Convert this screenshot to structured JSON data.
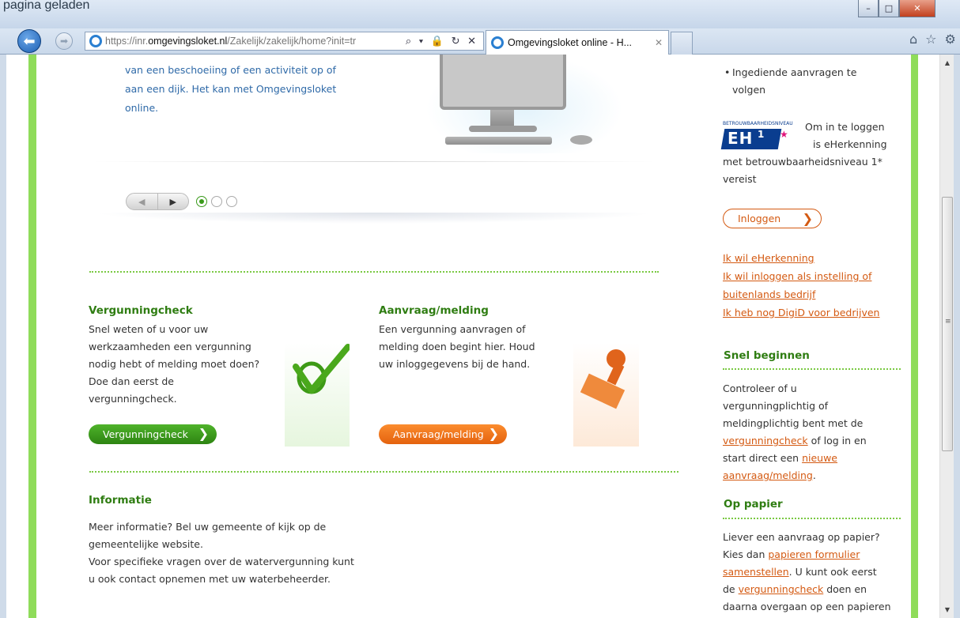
{
  "top_fragment": "pagina geladen",
  "window_controls": {
    "minimize": "–",
    "maximize": "□",
    "close": "✕"
  },
  "nav": {
    "back": "back",
    "forward": "forward"
  },
  "address": {
    "url_prefix": "https://inr.",
    "url_domain": "omgevingsloket.nl",
    "url_path": "/Zakelijk/zakelijk/home?init=tr",
    "controls": "⌕ ▾ 🔒 ↻ ✕"
  },
  "tab": {
    "title": "Omgevingsloket online - H...",
    "close": "✕"
  },
  "toolbar_icons": {
    "home": "⌂",
    "favorites": "☆",
    "tools": "⚙"
  },
  "hero": {
    "text_lines": [
      "van een beschoeiing of een activiteit op of",
      "aan een dijk. Het kan met Omgevingsloket",
      "online."
    ],
    "slider_prev": "◀",
    "slider_next": "▶",
    "slides": [
      {
        "active": true
      },
      {
        "active": false
      },
      {
        "active": false
      }
    ]
  },
  "vergunningcheck": {
    "heading": "Vergunningcheck",
    "lines": [
      "Snel weten of u voor uw",
      "werkzaamheden een vergunning",
      "nodig hebt of melding moet doen?",
      "Doe dan eerst de",
      "vergunningcheck."
    ],
    "button": "Vergunningcheck",
    "button_color": "#3a9a1a"
  },
  "aanvraag": {
    "heading": "Aanvraag/melding",
    "lines": [
      "Een vergunning aanvragen of",
      "melding doen begint hier. Houd",
      "uw inloggegevens bij de hand."
    ],
    "button": "Aanvraag/melding",
    "button_color": "#f07818"
  },
  "informatie": {
    "heading": "Informatie",
    "lines": [
      "Meer informatie? Bel uw gemeente of kijk op de",
      "gemeentelijke website.",
      "Voor specifieke vragen over de watervergunning kunt",
      "u ook contact opnemen met uw waterbeheerder."
    ]
  },
  "sidebar": {
    "bullet_lines": [
      "Ingediende aanvragen te",
      "volgen"
    ],
    "logo_caption": "BETROUWBAARHEIDSNIVEAU",
    "logo_text": "EH",
    "logo_num": "1",
    "login_text_lines": [
      "Om in te loggen",
      "is eHerkenning",
      "met betrouwbaarheidsniveau 1*",
      "vereist"
    ],
    "login_button": "Inloggen",
    "links": [
      "Ik wil eHerkenning",
      "Ik wil inloggen als instelling of",
      "buitenlands bedrijf",
      "Ik heb nog DigiD voor bedrijven"
    ],
    "snel": {
      "heading": "Snel beginnen",
      "line1": "Controleer of u",
      "line2": "vergunningplichtig of",
      "line3": "meldingplichtig bent met de",
      "link1": "vergunningcheck",
      "after1": " of log in en",
      "line5": "start direct een ",
      "link2a": "nieuwe",
      "link2b": "aanvraag/melding",
      "after2": "."
    },
    "papier": {
      "heading": "Op papier",
      "line1": "Liever een aanvraag op papier?",
      "line2": "Kies dan ",
      "link1a": "papieren formulier",
      "link1b": "samenstellen",
      "after1": ". U kunt ook eerst",
      "line4": "de ",
      "link2": "vergunningcheck",
      "after2": " doen en",
      "line5": "daarna overgaan op een papieren"
    }
  },
  "colors": {
    "green_accent": "#8fdc5a",
    "heading_green": "#2f7d12",
    "link_orange": "#d45a12",
    "text_blue": "#2f6aa8"
  }
}
